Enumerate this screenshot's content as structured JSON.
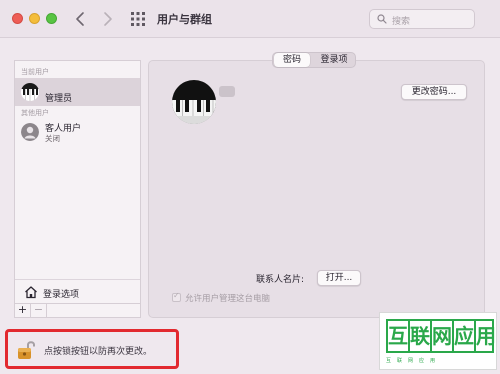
{
  "window": {
    "title": "用户与群组"
  },
  "search": {
    "placeholder": "搜索"
  },
  "sidebar": {
    "current_users_label": "当前用户",
    "other_users_label": "其他用户",
    "users": [
      {
        "name": "管理员",
        "status": "",
        "selected": true,
        "icon": "piano-avatar"
      },
      {
        "name": "客人用户",
        "status": "关闭",
        "selected": false,
        "icon": "guest-avatar"
      }
    ],
    "login_options_label": "登录选项",
    "add_label": "+",
    "remove_label": "−"
  },
  "tabs": [
    {
      "label": "密码",
      "selected": true
    },
    {
      "label": "登录项",
      "selected": false
    }
  ],
  "main": {
    "change_password_label": "更改密码...",
    "contact_card_label": "联系人名片:",
    "open_label": "打开...",
    "allow_admin_label": "允许用户管理这台电脑",
    "allow_admin_checked": true,
    "allow_admin_disabled": true
  },
  "lock": {
    "text": "点按锁按钮以防再次更改。",
    "icon": "lock-open-icon"
  },
  "watermark": {
    "chars": [
      "互",
      "联",
      "网",
      "应",
      "用"
    ],
    "sub": "互联网应用"
  },
  "colors": {
    "accent_red": "#e2292f",
    "watermark_green": "#2aa84a",
    "window_bg": "#efe8ee"
  }
}
